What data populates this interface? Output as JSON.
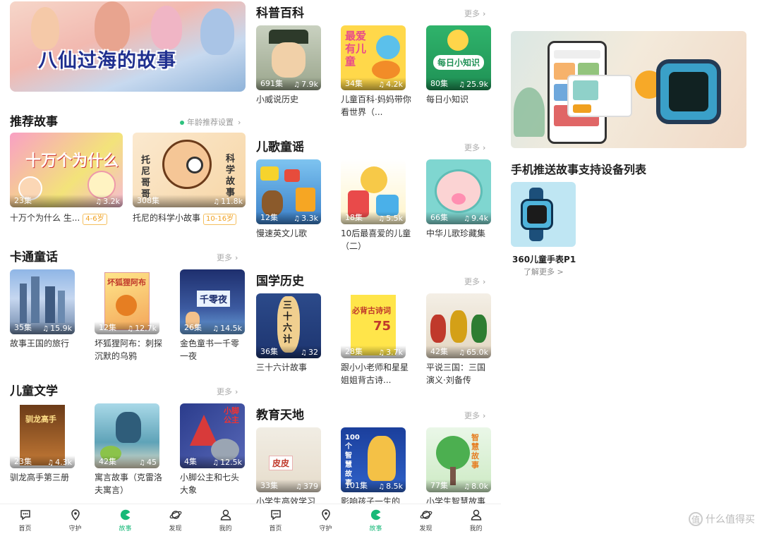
{
  "left": {
    "banner_title": "八仙过海的故事",
    "recommend": {
      "title": "推荐故事",
      "age_setting": "年龄推荐设置",
      "items": [
        {
          "name": "十万个为什么 生...",
          "episodes": "23集",
          "plays": "3.2k",
          "age": "4-6岁",
          "cover_text": "十万个为什么"
        },
        {
          "name": "托尼的科学小故事",
          "episodes": "308集",
          "plays": "11.8k",
          "age": "10-16岁",
          "cover_text": "托尼哥哥 科学故事"
        }
      ]
    },
    "cartoon": {
      "title": "卡通童话",
      "more": "更多",
      "items": [
        {
          "name": "故事王国的旅行",
          "episodes": "35集",
          "plays": "15.9k"
        },
        {
          "name": "坏狐狸阿布：刺探沉默的乌鸦",
          "episodes": "12集",
          "plays": "12.7k"
        },
        {
          "name": "金色童书一千零一夜",
          "episodes": "26集",
          "plays": "14.5k"
        }
      ]
    },
    "literature": {
      "title": "儿童文学",
      "more": "更多",
      "items": [
        {
          "name": "驯龙高手第三册",
          "episodes": "23集",
          "plays": "4.3k"
        },
        {
          "name": "寓言故事（克雷洛夫寓言）",
          "episodes": "42集",
          "plays": "45"
        },
        {
          "name": "小脚公主和七头大象",
          "episodes": "4集",
          "plays": "12.5k"
        }
      ]
    },
    "tabs": [
      "首页",
      "守护",
      "故事",
      "发现",
      "我的"
    ]
  },
  "mid": {
    "science": {
      "title": "科普百科",
      "more": "更多",
      "items": [
        {
          "name": "小威说历史",
          "episodes": "691集",
          "plays": "7.9k"
        },
        {
          "name": "儿童百科·妈妈带你看世界（...",
          "episodes": "34集",
          "plays": "4.2k"
        },
        {
          "name": "每日小知识",
          "episodes": "80集",
          "plays": "25.9k"
        }
      ]
    },
    "songs": {
      "title": "儿歌童谣",
      "more": "更多",
      "items": [
        {
          "name": "慢速英文儿歌",
          "episodes": "12集",
          "plays": "3.3k"
        },
        {
          "name": "10后最喜爱的儿童（二）",
          "episodes": "18集",
          "plays": "5.5k"
        },
        {
          "name": "中华儿歌珍藏集",
          "episodes": "66集",
          "plays": "9.4k"
        }
      ]
    },
    "history": {
      "title": "国学历史",
      "more": "更多",
      "items": [
        {
          "name": "三十六计故事",
          "episodes": "36集",
          "plays": "32"
        },
        {
          "name": "跟小小老师和星星姐姐背古诗...",
          "episodes": "28集",
          "plays": "3.7k"
        },
        {
          "name": "平说三国：三国演义·刘备传",
          "episodes": "42集",
          "plays": "65.0k"
        }
      ]
    },
    "education": {
      "title": "教育天地",
      "more": "更多",
      "items": [
        {
          "name": "小学生高效学习",
          "episodes": "33集",
          "plays": "379"
        },
        {
          "name": "影响孩子一生的",
          "episodes": "101集",
          "plays": "8.5k"
        },
        {
          "name": "小学生智慧故事",
          "episodes": "77集",
          "plays": "8.0k"
        }
      ]
    },
    "tabs": [
      "首页",
      "守护",
      "故事",
      "发现",
      "我的"
    ]
  },
  "right": {
    "device_list_title": "手机推送故事支持设备列表",
    "device_name": "360儿童手表P1",
    "device_more": "了解更多 >",
    "watermark": "什么值得买",
    "watermark_icon": "值"
  },
  "colors": {
    "accent": "#17b978",
    "age_tag": "#f0a020"
  }
}
